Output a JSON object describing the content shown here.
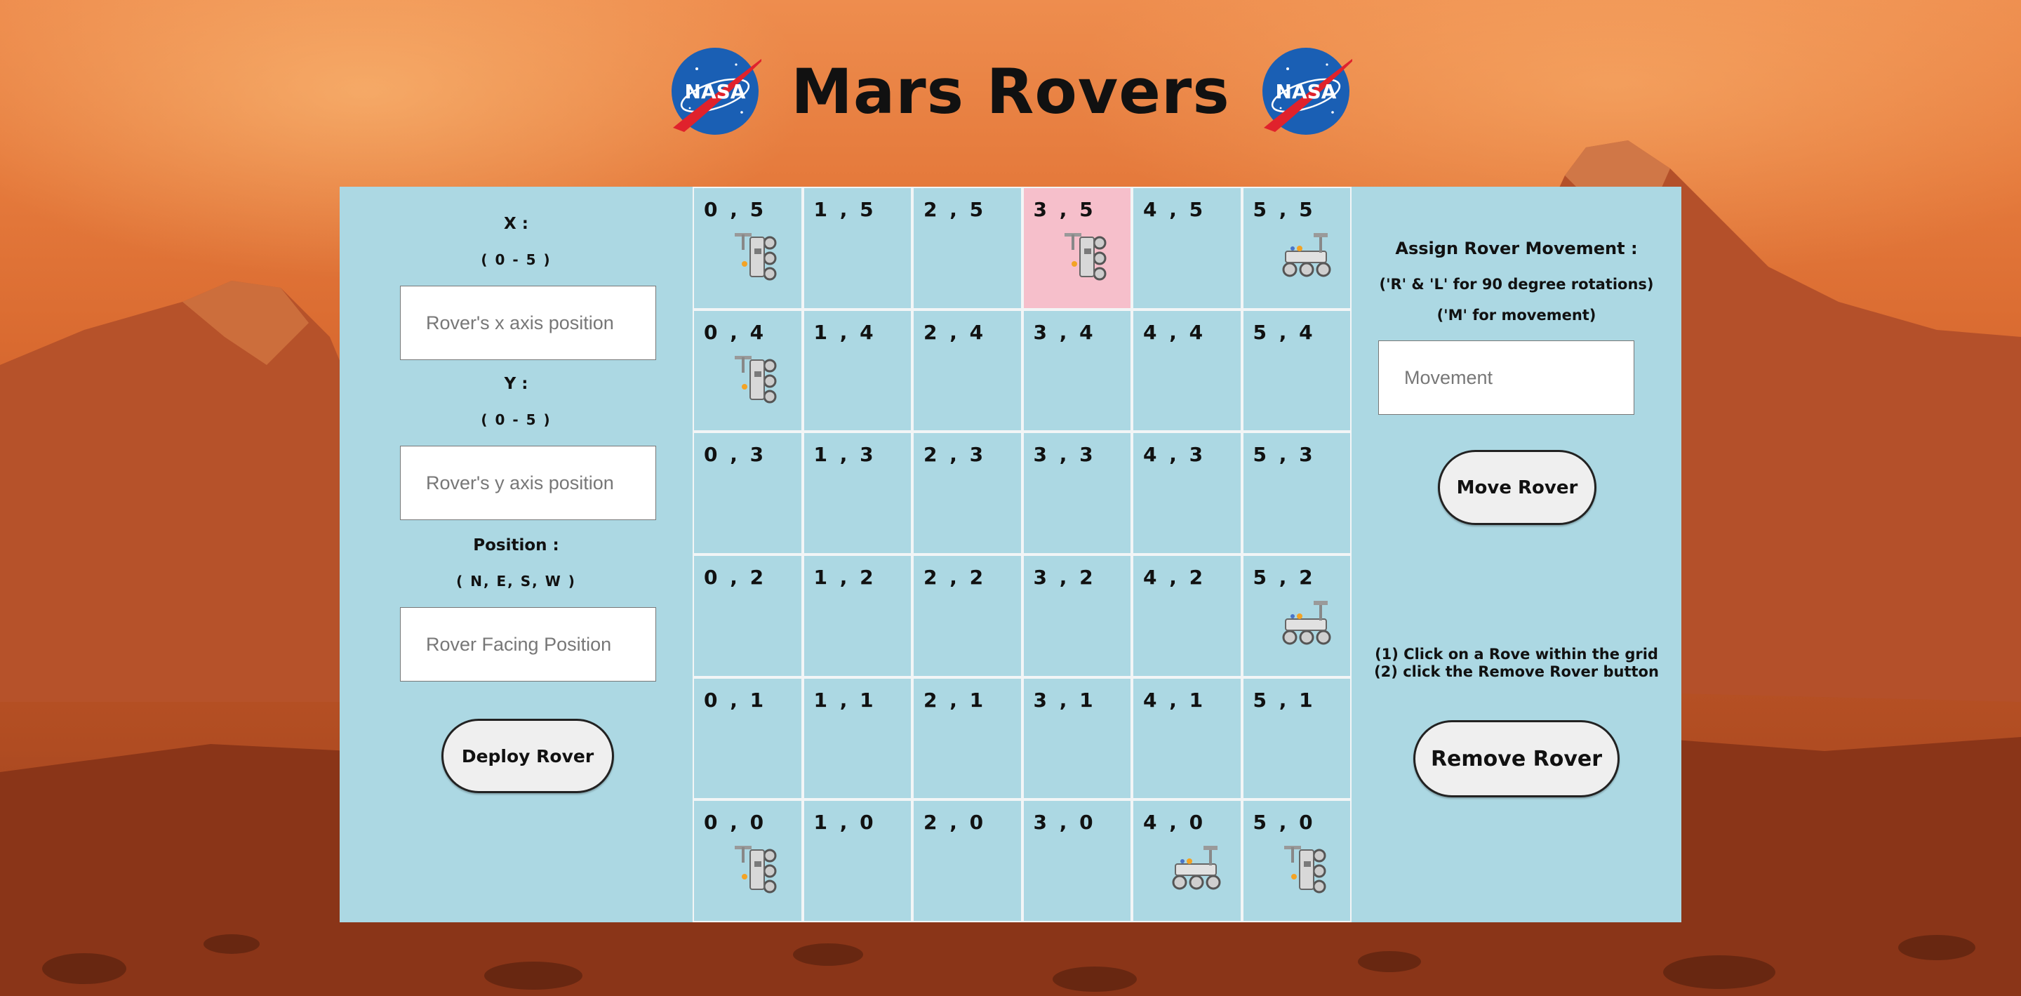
{
  "header": {
    "title": "Mars Rovers",
    "logo_text": "NASA"
  },
  "left_form": {
    "x_label": "X :",
    "x_range": "( 0 - 5 )",
    "x_placeholder": "Rover's x axis position",
    "y_label": "Y :",
    "y_range": "( 0 - 5 )",
    "y_placeholder": "Rover's y axis position",
    "position_label": "Position :",
    "position_range": "( N, E, S, W )",
    "position_placeholder": "Rover Facing Position",
    "deploy_button": "Deploy Rover"
  },
  "right_form": {
    "heading": "Assign Rover Movement :",
    "hint_rotation": "('R' & 'L' for 90 degree rotations)",
    "hint_movement": "('M' for movement)",
    "movement_placeholder": "Movement",
    "move_button": "Move Rover",
    "instruction_1": "(1) Click on a Rove within the grid",
    "instruction_2": "(2) click the Remove Rover button",
    "remove_button": "Remove Rover"
  },
  "grid": {
    "rows": [
      [
        {
          "c": "0 , 5",
          "rover": "north"
        },
        {
          "c": "1 , 5"
        },
        {
          "c": "2 , 5"
        },
        {
          "c": "3 , 5",
          "rover": "north",
          "selected": true
        },
        {
          "c": "4 , 5"
        },
        {
          "c": "5 , 5",
          "rover": "west"
        }
      ],
      [
        {
          "c": "0 , 4",
          "rover": "north"
        },
        {
          "c": "1 , 4"
        },
        {
          "c": "2 , 4"
        },
        {
          "c": "3 , 4"
        },
        {
          "c": "4 , 4"
        },
        {
          "c": "5 , 4"
        }
      ],
      [
        {
          "c": "0 , 3"
        },
        {
          "c": "1 , 3"
        },
        {
          "c": "2 , 3"
        },
        {
          "c": "3 , 3"
        },
        {
          "c": "4 , 3"
        },
        {
          "c": "5 , 3"
        }
      ],
      [
        {
          "c": "0 , 2"
        },
        {
          "c": "1 , 2"
        },
        {
          "c": "2 , 2"
        },
        {
          "c": "3 , 2"
        },
        {
          "c": "4 , 2"
        },
        {
          "c": "5 , 2",
          "rover": "west"
        }
      ],
      [
        {
          "c": "0 , 1"
        },
        {
          "c": "1 , 1"
        },
        {
          "c": "2 , 1"
        },
        {
          "c": "3 , 1"
        },
        {
          "c": "4 , 1"
        },
        {
          "c": "5 , 1"
        }
      ],
      [
        {
          "c": "0 , 0",
          "rover": "north"
        },
        {
          "c": "1 , 0"
        },
        {
          "c": "2 , 0"
        },
        {
          "c": "3 , 0"
        },
        {
          "c": "4 , 0",
          "rover": "west"
        },
        {
          "c": "5 , 0",
          "rover": "north"
        }
      ]
    ]
  },
  "colors": {
    "panel": "#acd8e3",
    "selected_cell": "#f6bfcb",
    "nasa_blue": "#1a5fb4",
    "nasa_red": "#e0222c"
  }
}
